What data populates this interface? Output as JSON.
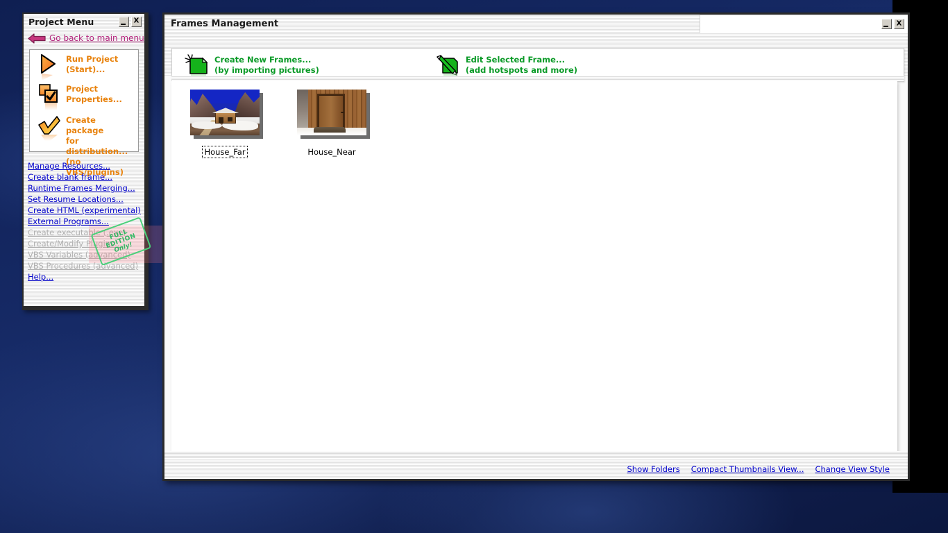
{
  "desktop": {
    "background_color": "#14265e"
  },
  "project_menu": {
    "title": "Project Menu",
    "minimize_label": "_",
    "close_label": "X",
    "back_link": "Go back to main menu",
    "back_icon": "arrow-left-icon",
    "actions": [
      {
        "icon": "play-triangle-icon",
        "lines": [
          "Run Project",
          "(Start)..."
        ]
      },
      {
        "icon": "checked-squares-icon",
        "lines": [
          "Project",
          "Properties..."
        ]
      },
      {
        "icon": "orange-checkmark-icon",
        "lines": [
          "Create package",
          "for distribution...",
          "(no VBS/plugins)"
        ]
      }
    ],
    "links": [
      {
        "label": "Manage Resources...",
        "enabled": true
      },
      {
        "label": "Create blank frame...",
        "enabled": true
      },
      {
        "label": "Runtime Frames Merging...",
        "enabled": true
      },
      {
        "label": "Set Resume Locations...",
        "enabled": true
      },
      {
        "label": "Create HTML (experimental)",
        "enabled": true
      },
      {
        "label": "External Programs...",
        "enabled": true
      },
      {
        "label": "Create executable (.exe)",
        "enabled": false
      },
      {
        "label": "Create/Modify Plugins...",
        "enabled": false
      },
      {
        "label": "VBS Variables (advanced)",
        "enabled": false
      },
      {
        "label": "VBS Procedures (advanced)",
        "enabled": false
      },
      {
        "label": "Help...",
        "enabled": true
      }
    ],
    "stamp": {
      "line1": "FULL",
      "line2": "EDITION",
      "line3": "Only!",
      "color": "#2fb862"
    },
    "accent_color": "#e8820c",
    "link_color": "#0000cc",
    "back_link_color": "#b2227b"
  },
  "frames_window": {
    "title": "Frames Management",
    "minimize_label": "_",
    "close_label": "X",
    "toolbar": [
      {
        "icon": "new-page-sparkle-icon",
        "line1": "Create New Frames...",
        "line2": "(by importing pictures)"
      },
      {
        "icon": "pencil-page-icon",
        "line1": "Edit Selected Frame...",
        "line2": "(add hotspots and more)"
      }
    ],
    "toolbar_text_color": "#0a9a27",
    "thumbnails": [
      {
        "caption": "House_Far",
        "selected": true,
        "picture": "mountain-hut-snow"
      },
      {
        "caption": "House_Near",
        "selected": false,
        "picture": "wooden-door"
      }
    ],
    "bottom_links": [
      "Show Folders",
      "Compact Thumbnails View...",
      "Change View Style"
    ]
  }
}
